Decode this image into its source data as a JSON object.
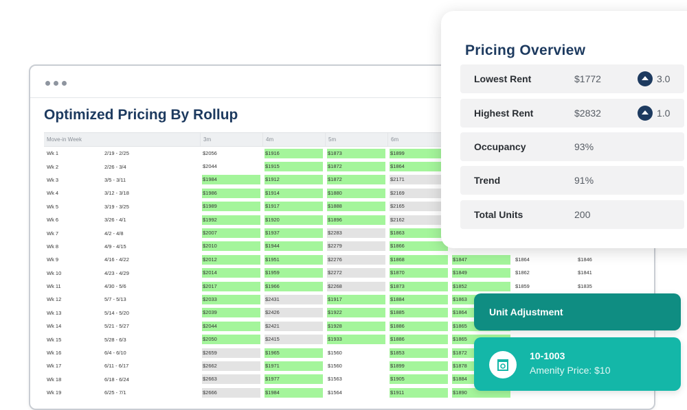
{
  "main": {
    "title": "Optimized Pricing By Rollup",
    "columns": [
      "Move-in Week",
      "3m",
      "4m",
      "5m",
      "6m",
      "",
      "",
      ""
    ],
    "rows": [
      {
        "week": "Wk 1",
        "dates": "2/19 - 2/25",
        "p": [
          [
            "$2056",
            "n"
          ],
          [
            "$1916",
            "g"
          ],
          [
            "$1873",
            "g"
          ],
          [
            "$1899",
            "g"
          ]
        ]
      },
      {
        "week": "Wk 2",
        "dates": "2/26 - 3/4",
        "p": [
          [
            "$2044",
            "n"
          ],
          [
            "$1915",
            "g"
          ],
          [
            "$1872",
            "g"
          ],
          [
            "$1864",
            "g"
          ]
        ]
      },
      {
        "week": "Wk 3",
        "dates": "3/5 - 3/11",
        "p": [
          [
            "$1984",
            "g"
          ],
          [
            "$1912",
            "g"
          ],
          [
            "$1872",
            "g"
          ],
          [
            "$2171",
            "r"
          ]
        ]
      },
      {
        "week": "Wk 4",
        "dates": "3/12 - 3/18",
        "p": [
          [
            "$1986",
            "g"
          ],
          [
            "$1914",
            "g"
          ],
          [
            "$1880",
            "g"
          ],
          [
            "$2169",
            "r"
          ]
        ]
      },
      {
        "week": "Wk 5",
        "dates": "3/19 - 3/25",
        "p": [
          [
            "$1989",
            "g"
          ],
          [
            "$1917",
            "g"
          ],
          [
            "$1888",
            "g"
          ],
          [
            "$2165",
            "r"
          ]
        ]
      },
      {
        "week": "Wk 6",
        "dates": "3/26 - 4/1",
        "p": [
          [
            "$1992",
            "g"
          ],
          [
            "$1920",
            "g"
          ],
          [
            "$1896",
            "g"
          ],
          [
            "$2162",
            "r"
          ]
        ]
      },
      {
        "week": "Wk 7",
        "dates": "4/2 - 4/8",
        "p": [
          [
            "$2007",
            "g"
          ],
          [
            "$1937",
            "g"
          ],
          [
            "$2283",
            "r"
          ],
          [
            "$1863",
            "g"
          ]
        ]
      },
      {
        "week": "Wk 8",
        "dates": "4/9 - 4/15",
        "p": [
          [
            "$2010",
            "g"
          ],
          [
            "$1944",
            "g"
          ],
          [
            "$2279",
            "r"
          ],
          [
            "$1866",
            "g"
          ]
        ]
      },
      {
        "week": "Wk 9",
        "dates": "4/16 - 4/22",
        "p": [
          [
            "$2012",
            "g"
          ],
          [
            "$1951",
            "g"
          ],
          [
            "$2276",
            "r"
          ],
          [
            "$1868",
            "g"
          ],
          [
            "$1847",
            "g"
          ],
          [
            "$1864",
            "n"
          ],
          [
            "$1846",
            "n"
          ]
        ]
      },
      {
        "week": "Wk 10",
        "dates": "4/23 - 4/29",
        "p": [
          [
            "$2014",
            "g"
          ],
          [
            "$1959",
            "g"
          ],
          [
            "$2272",
            "r"
          ],
          [
            "$1870",
            "g"
          ],
          [
            "$1849",
            "g"
          ],
          [
            "$1862",
            "n"
          ],
          [
            "$1841",
            "n"
          ]
        ]
      },
      {
        "week": "Wk 11",
        "dates": "4/30 - 5/6",
        "p": [
          [
            "$2017",
            "g"
          ],
          [
            "$1966",
            "g"
          ],
          [
            "$2268",
            "r"
          ],
          [
            "$1873",
            "g"
          ],
          [
            "$1852",
            "g"
          ],
          [
            "$1859",
            "n"
          ],
          [
            "$1835",
            "n"
          ]
        ]
      },
      {
        "week": "Wk 12",
        "dates": "5/7 - 5/13",
        "p": [
          [
            "$2033",
            "g"
          ],
          [
            "$2431",
            "r"
          ],
          [
            "$1917",
            "g"
          ],
          [
            "$1884",
            "g"
          ],
          [
            "$1863",
            "g"
          ]
        ]
      },
      {
        "week": "Wk 13",
        "dates": "5/14 - 5/20",
        "p": [
          [
            "$2039",
            "g"
          ],
          [
            "$2426",
            "r"
          ],
          [
            "$1922",
            "g"
          ],
          [
            "$1885",
            "g"
          ],
          [
            "$1864",
            "g"
          ]
        ]
      },
      {
        "week": "Wk 14",
        "dates": "5/21 - 5/27",
        "p": [
          [
            "$2044",
            "g"
          ],
          [
            "$2421",
            "r"
          ],
          [
            "$1928",
            "g"
          ],
          [
            "$1886",
            "g"
          ],
          [
            "$1865",
            "g"
          ]
        ]
      },
      {
        "week": "Wk 15",
        "dates": "5/28 - 6/3",
        "p": [
          [
            "$2050",
            "g"
          ],
          [
            "$2415",
            "r"
          ],
          [
            "$1933",
            "g"
          ],
          [
            "$1886",
            "g"
          ],
          [
            "$1865",
            "g"
          ]
        ]
      },
      {
        "week": "Wk 16",
        "dates": "6/4 - 6/10",
        "p": [
          [
            "$2659",
            "r"
          ],
          [
            "$1965",
            "g"
          ],
          [
            "$1560",
            "n"
          ],
          [
            "$1853",
            "g"
          ],
          [
            "$1872",
            "g"
          ]
        ]
      },
      {
        "week": "Wk 17",
        "dates": "6/11 - 6/17",
        "p": [
          [
            "$2662",
            "r"
          ],
          [
            "$1971",
            "g"
          ],
          [
            "$1560",
            "n"
          ],
          [
            "$1899",
            "g"
          ],
          [
            "$1878",
            "g"
          ]
        ]
      },
      {
        "week": "Wk 18",
        "dates": "6/18 - 6/24",
        "p": [
          [
            "$2663",
            "r"
          ],
          [
            "$1977",
            "g"
          ],
          [
            "$1563",
            "n"
          ],
          [
            "$1905",
            "g"
          ],
          [
            "$1884",
            "g"
          ]
        ]
      },
      {
        "week": "Wk 19",
        "dates": "6/25 - 7/1",
        "p": [
          [
            "$2666",
            "r"
          ],
          [
            "$1984",
            "g"
          ],
          [
            "$1564",
            "n"
          ],
          [
            "$1911",
            "g"
          ],
          [
            "$1890",
            "g"
          ]
        ]
      }
    ]
  },
  "overview": {
    "title": "Pricing Overview",
    "rows": [
      {
        "label": "Lowest Rent",
        "value": "$1772",
        "badge": "3.0"
      },
      {
        "label": "Highest Rent",
        "value": "$2832",
        "badge": "1.0"
      },
      {
        "label": "Occupancy",
        "value": "93%"
      },
      {
        "label": "Trend",
        "value": "91%"
      },
      {
        "label": "Total Units",
        "value": "200"
      }
    ]
  },
  "unit_adjustment": {
    "title": "Unit Adjustment",
    "unit_code": "10-1003",
    "description": "Amenity Price: $10"
  },
  "colors": {
    "navy": "#1d3a5f",
    "green_cell": "#a4f59b",
    "teal_dark": "#0f8d82",
    "teal": "#14b7a8"
  }
}
